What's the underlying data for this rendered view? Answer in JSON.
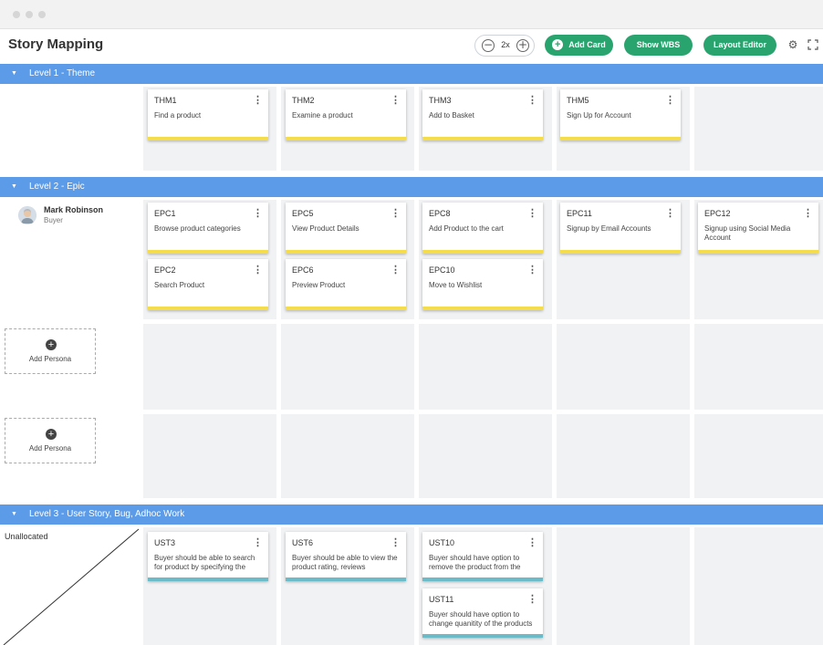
{
  "app": {
    "title": "Story Mapping"
  },
  "toolbar": {
    "zoom_value": "2x",
    "zoom_out_icon": "minus-circle-icon",
    "zoom_in_icon": "plus-circle-icon",
    "add_card_label": "Add Card",
    "show_wbs_label": "Show WBS",
    "layout_editor_label": "Layout Editor",
    "settings_icon": "gear-icon",
    "fullscreen_icon": "expand-icon",
    "accent_color": "#2aa46e"
  },
  "levels": {
    "theme": "Level 1 - Theme",
    "epic": "Level 2 - Epic",
    "story": "Level 3 - User Story, Bug, Adhoc Work"
  },
  "level_bar_color": "#5b9be8",
  "persona": {
    "name": "Mark Robinson",
    "role": "Buyer"
  },
  "add_persona_label": "Add Persona",
  "unallocated_label": "Unallocated",
  "stripe_colors": {
    "theme_epic": "#f5dc4a",
    "story": "#6bbbc9"
  },
  "theme_cards": [
    {
      "id": "THM1",
      "text": "Find a product"
    },
    {
      "id": "THM2",
      "text": "Examine a product"
    },
    {
      "id": "THM3",
      "text": "Add to Basket"
    },
    {
      "id": "THM5",
      "text": "Sign Up for Account"
    }
  ],
  "epic_cards": [
    {
      "id": "EPC1",
      "text": "Browse product categories"
    },
    {
      "id": "EPC5",
      "text": "View Product Details"
    },
    {
      "id": "EPC8",
      "text": "Add Product to the cart"
    },
    {
      "id": "EPC11",
      "text": "Signup by Email Accounts"
    },
    {
      "id": "EPC12",
      "text": "Signup using Social Media Account"
    },
    {
      "id": "EPC2",
      "text": "Search Product"
    },
    {
      "id": "EPC6",
      "text": "Preview Product"
    },
    {
      "id": "EPC10",
      "text": "Move to Wishlist"
    }
  ],
  "story_cards": [
    {
      "id": "UST3",
      "text": "Buyer should be able to search for product by specifying the"
    },
    {
      "id": "UST6",
      "text": "Buyer should be able to view the product rating, reviews"
    },
    {
      "id": "UST10",
      "text": "Buyer should have option to remove the product from the"
    },
    {
      "id": "UST11",
      "text": "Buyer should have option to change quanitity of the products"
    }
  ]
}
